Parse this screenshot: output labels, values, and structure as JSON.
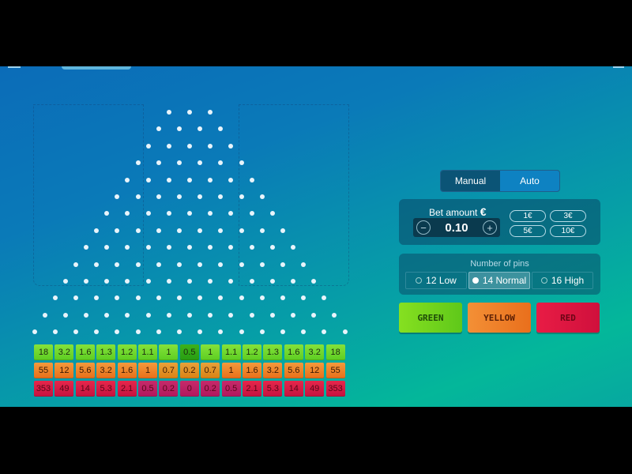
{
  "game": {
    "pin_rows": 14,
    "first_row_pins": 3,
    "multipliers": {
      "green": [
        "18",
        "3.2",
        "1.6",
        "1.3",
        "1.2",
        "1.1",
        "1",
        "0.5",
        "1",
        "1.1",
        "1.2",
        "1.3",
        "1.6",
        "3.2",
        "18"
      ],
      "yellow": [
        "55",
        "12",
        "5.6",
        "3.2",
        "1.6",
        "1",
        "0.7",
        "0.2",
        "0.7",
        "1",
        "1.6",
        "3.2",
        "5.6",
        "12",
        "55"
      ],
      "red": [
        "353",
        "49",
        "14",
        "5.3",
        "2.1",
        "0.5",
        "0.2",
        "0",
        "0.2",
        "0.5",
        "2.1",
        "5.3",
        "14",
        "49",
        "353"
      ]
    }
  },
  "controls": {
    "mode_tabs": [
      {
        "label": "Manual",
        "active": true
      },
      {
        "label": "Auto",
        "active": false
      }
    ],
    "bet": {
      "label": "Bet amount",
      "currency": "€",
      "value": "0.10",
      "minus_icon": "minus-circle-icon",
      "plus_icon": "plus-circle-icon",
      "chips": [
        "1€",
        "3€",
        "5€",
        "10€"
      ]
    },
    "pins": {
      "title": "Number of pins",
      "options": [
        {
          "label": "12 Low",
          "selected": false
        },
        {
          "label": "14 Normal",
          "selected": true
        },
        {
          "label": "16 High",
          "selected": false
        }
      ]
    },
    "color_buttons": {
      "green": "GREEN",
      "yellow": "YELLOW",
      "red": "RED"
    }
  },
  "colors": {
    "green": "#6cd428",
    "yellow": "#ec7c26",
    "red": "#d81540"
  }
}
